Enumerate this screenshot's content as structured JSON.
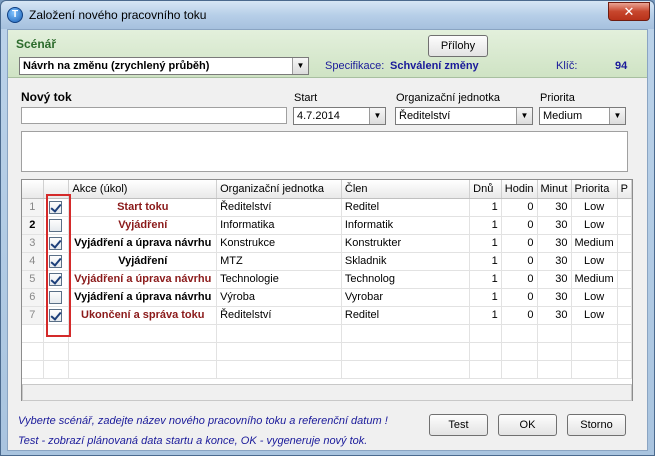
{
  "window": {
    "title": "Založení nového pracovního toku",
    "close_glyph": "✕",
    "icon_glyph": "T"
  },
  "header": {
    "scenario_label": "Scénář",
    "attachments_button": "Přílohy",
    "scenario_value": "Návrh na změnu (zrychlený průběh)",
    "spec_label": "Specifikace:",
    "spec_value": "Schválení změny",
    "key_label": "Klíč:",
    "key_value": "94"
  },
  "form": {
    "new_flow_label": "Nový tok",
    "new_flow_value": "",
    "start_label": "Start",
    "start_value": "4.7.2014",
    "org_label": "Organizační jednotka",
    "org_value": "Ředitelství",
    "priority_label": "Priorita",
    "priority_value": "Medium",
    "dropdown_glyph": "▼"
  },
  "grid": {
    "columns": [
      "",
      "",
      "Akce (úkol)",
      "Organizační jednotka",
      "Člen",
      "Dnů",
      "Hodin",
      "Minut",
      "Priorita",
      "P"
    ],
    "rows": [
      {
        "n": "1",
        "checked": true,
        "action": "Start toku",
        "org": "Ředitelství",
        "member": "Reditel",
        "days": "1",
        "hours": "0",
        "minutes": "30",
        "priority": "Low"
      },
      {
        "n": "2",
        "checked": false,
        "action": "Vyjádření",
        "org": "Informatika",
        "member": "Informatik",
        "days": "1",
        "hours": "0",
        "minutes": "30",
        "priority": "Low"
      },
      {
        "n": "3",
        "checked": true,
        "action": "Vyjádření a úprava návrhu",
        "org": "Konstrukce",
        "member": "Konstrukter",
        "days": "1",
        "hours": "0",
        "minutes": "30",
        "priority": "Medium"
      },
      {
        "n": "4",
        "checked": true,
        "action": "Vyjádření",
        "org": "MTZ",
        "member": "Skladnik",
        "days": "1",
        "hours": "0",
        "minutes": "30",
        "priority": "Low"
      },
      {
        "n": "5",
        "checked": true,
        "action": "Vyjádření a úprava návrhu",
        "org": "Technologie",
        "member": "Technolog",
        "days": "1",
        "hours": "0",
        "minutes": "30",
        "priority": "Medium"
      },
      {
        "n": "6",
        "checked": false,
        "action": "Vyjádření a úprava návrhu",
        "org": "Výroba",
        "member": "Vyrobar",
        "days": "1",
        "hours": "0",
        "minutes": "30",
        "priority": "Low"
      },
      {
        "n": "7",
        "checked": true,
        "action": "Ukončení a správa toku",
        "org": "Ředitelství",
        "member": "Reditel",
        "days": "1",
        "hours": "0",
        "minutes": "30",
        "priority": "Low"
      }
    ]
  },
  "footer": {
    "hint_line1": "Vyberte scénář, zadejte název nového pracovního toku a referenční datum !",
    "hint_line2": "Test - zobrazí plánovaná data startu a konce, OK - vygeneruje nový tok.",
    "test_button": "Test",
    "ok_button": "OK",
    "cancel_button": "Storno"
  },
  "colors": {
    "header_green": "#2c6b2c",
    "hint_blue": "#1a1a9a",
    "action_red": "#8b1a1a",
    "highlight_frame": "#d42a2a"
  }
}
